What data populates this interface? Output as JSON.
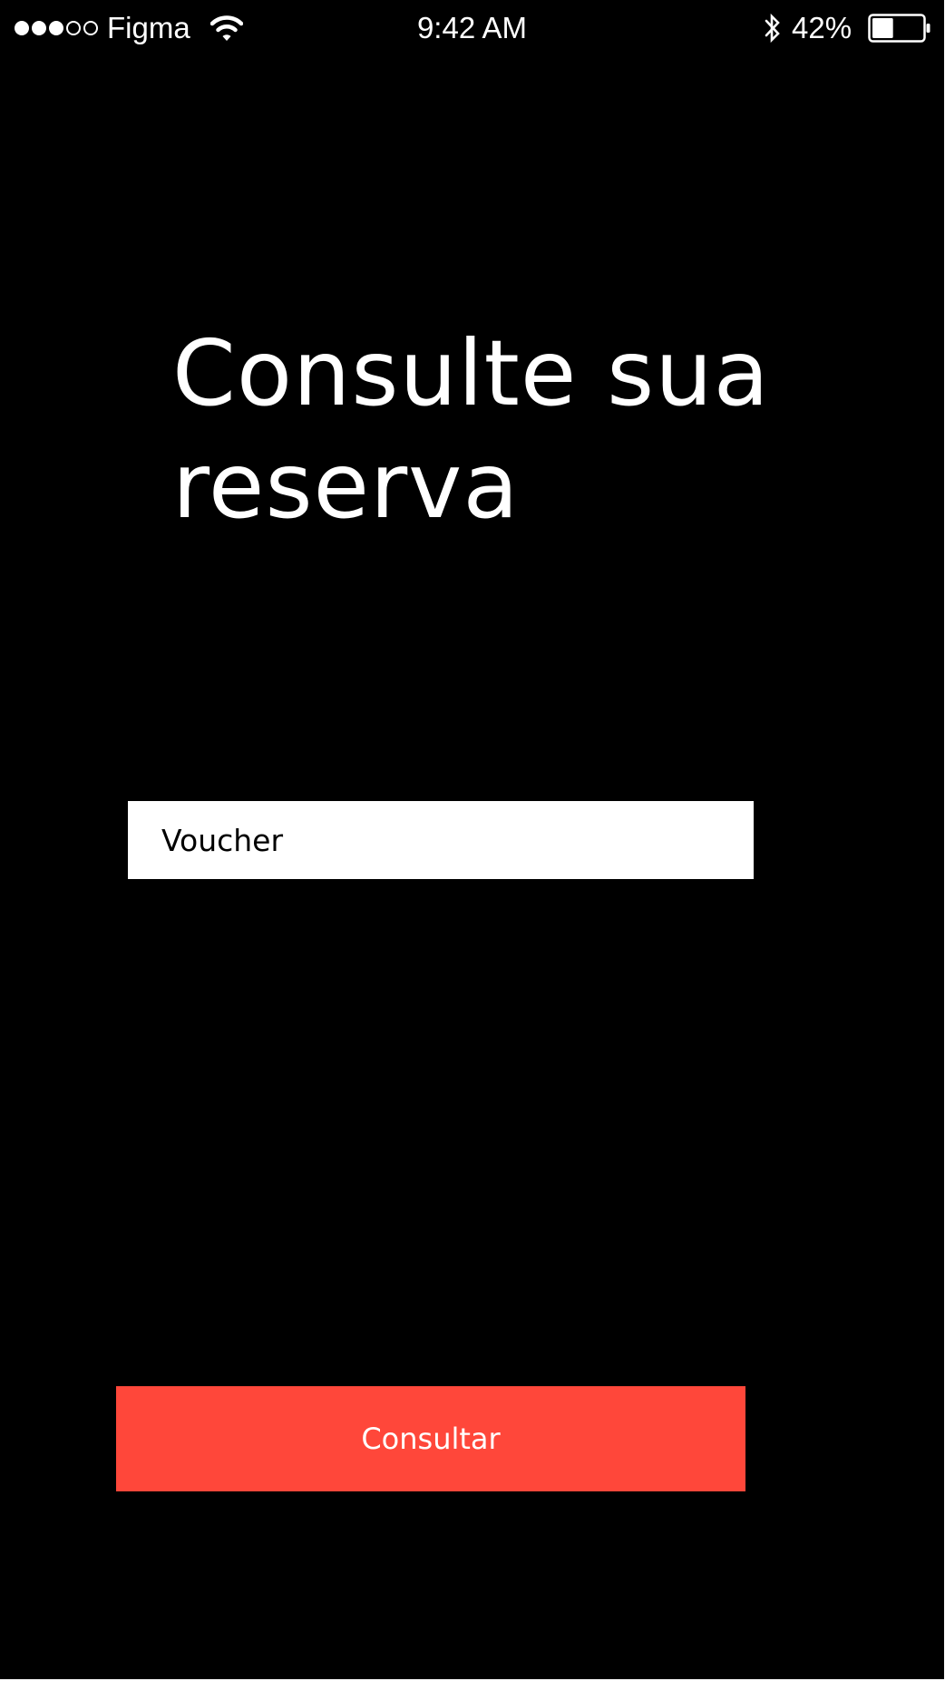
{
  "status_bar": {
    "signal_bars_filled": 3,
    "signal_bars_total": 5,
    "carrier": "Figma",
    "wifi_icon": "wifi-icon",
    "time": "9:42 AM",
    "bluetooth_icon": "bluetooth-icon",
    "battery_percent": "42%",
    "battery_level": 0.42,
    "battery_icon": "battery-icon"
  },
  "main": {
    "title": "Consulte sua reserva",
    "voucher_field": {
      "placeholder": "Voucher",
      "value": ""
    },
    "consult_button_label": "Consultar"
  },
  "colors": {
    "background": "#000000",
    "text": "#ffffff",
    "input_background": "#ffffff",
    "accent": "#ff473a"
  }
}
